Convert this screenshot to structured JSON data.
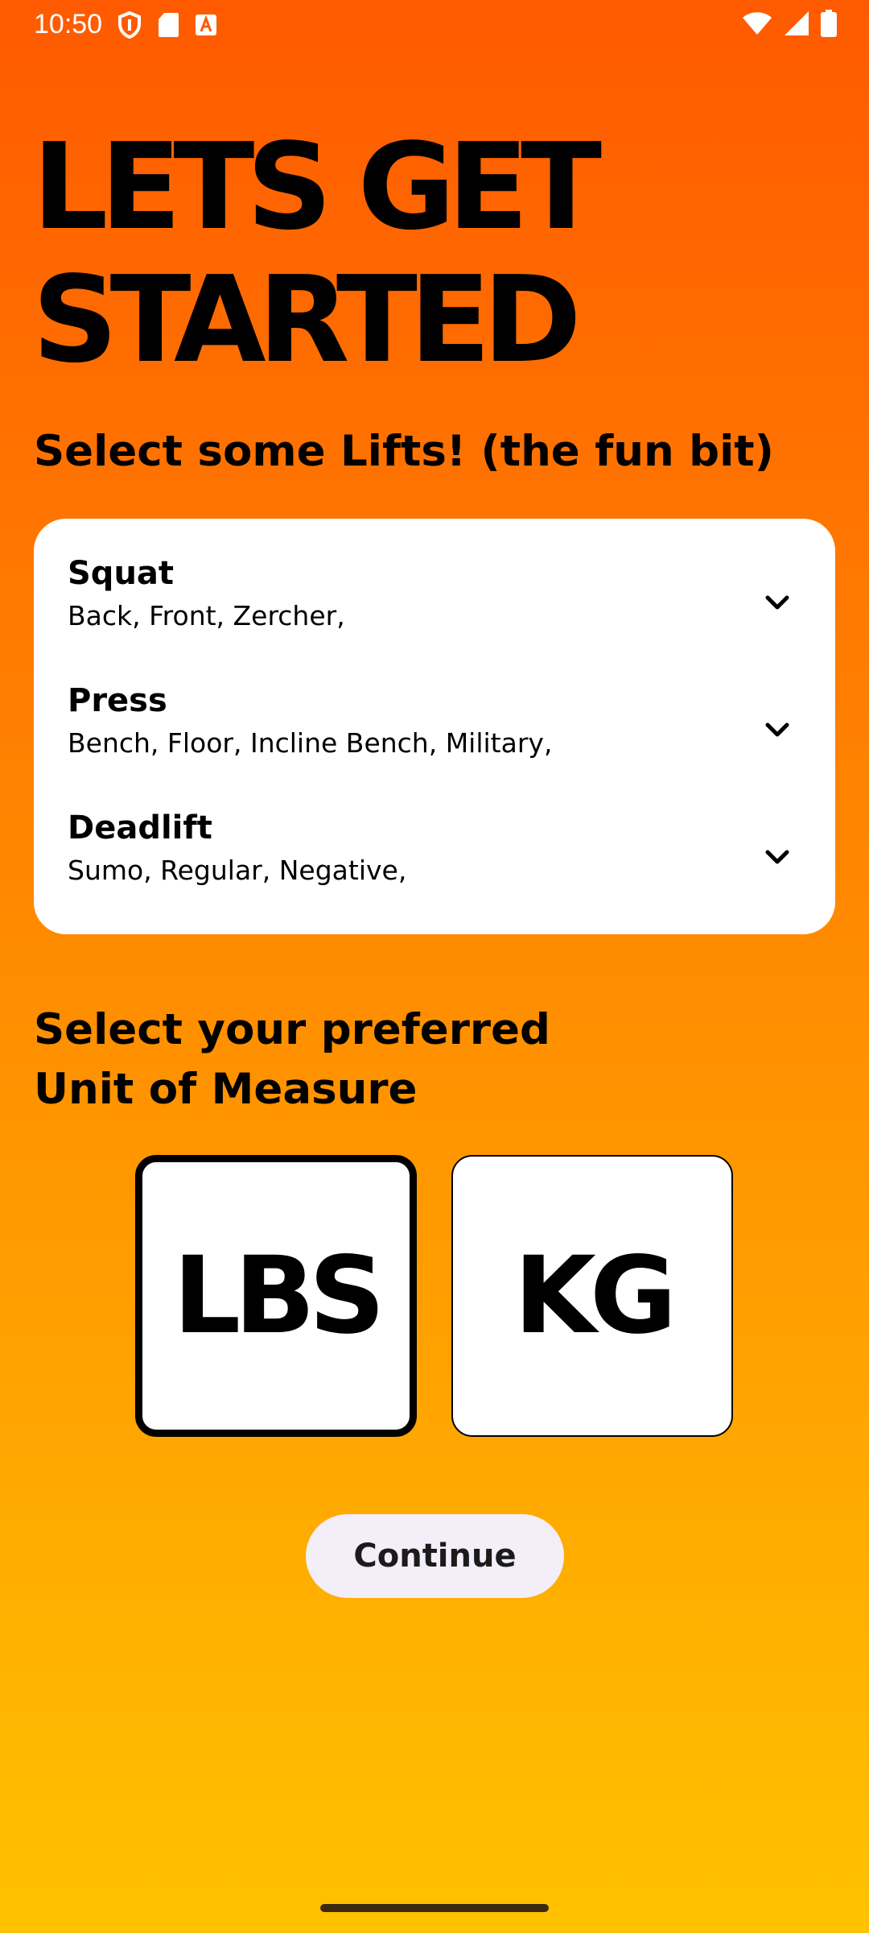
{
  "status_bar": {
    "time": "10:50",
    "left_icons": [
      "shield-icon",
      "sd-card-icon",
      "font-download-icon"
    ],
    "right_icons": [
      "wifi-icon",
      "cell-signal-icon",
      "battery-icon"
    ]
  },
  "headline": {
    "line1": "LETS GET",
    "line2": "STARTED"
  },
  "lifts_section": {
    "title": "Select some Lifts! (the fun bit)",
    "items": [
      {
        "name": "Squat",
        "variants": "Back, Front, Zercher,",
        "icon": "chevron-down-icon"
      },
      {
        "name": "Press",
        "variants": "Bench, Floor, Incline Bench, Military,",
        "icon": "chevron-down-icon"
      },
      {
        "name": "Deadlift",
        "variants": "Sumo, Regular, Negative,",
        "icon": "chevron-down-icon"
      }
    ]
  },
  "uom_section": {
    "title_line1": "Select your preferred",
    "title_line2": "Unit of Measure",
    "options": [
      {
        "label": "LBS",
        "selected": true
      },
      {
        "label": "KG",
        "selected": false
      }
    ]
  },
  "continue_label": "Continue",
  "colors": {
    "gradient_top": "#ff5a00",
    "gradient_bottom": "#ffc200",
    "card": "#ffffff",
    "button": "#f3eef7",
    "text": "#000000"
  }
}
